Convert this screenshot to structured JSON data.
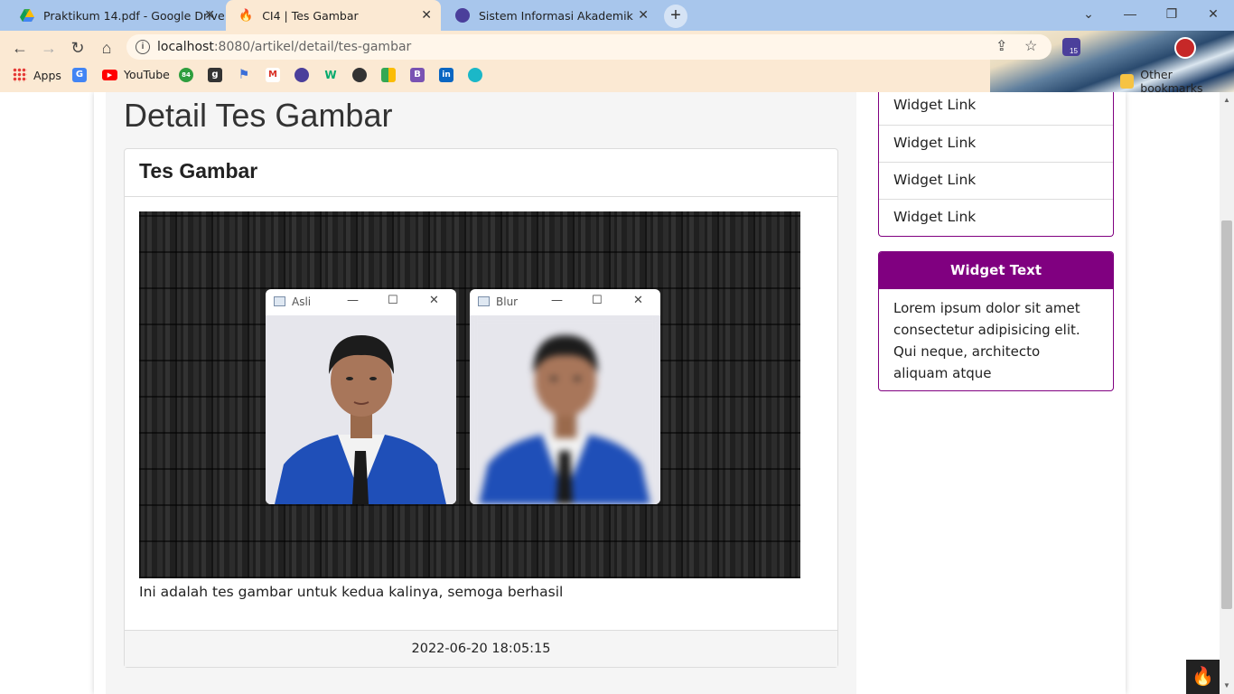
{
  "browser": {
    "tabs": [
      {
        "title": "Praktikum 14.pdf - Google Drive",
        "icon": "google-drive-icon",
        "active": false
      },
      {
        "title": "CI4 | Tes Gambar",
        "icon": "codeigniter-icon",
        "active": true
      },
      {
        "title": "Sistem Informasi Akademik",
        "icon": "campus-icon",
        "active": false
      }
    ],
    "new_tab_label": "+",
    "url_host": "localhost",
    "url_rest": ":8080/artikel/detail/tes-gambar",
    "profile_badge": "15",
    "bookmarks": [
      {
        "label": "Apps",
        "icon": "apps-grid-icon"
      },
      {
        "label": "",
        "icon": "google-translate-icon"
      },
      {
        "label": "YouTube",
        "icon": "youtube-icon"
      },
      {
        "label": "",
        "icon": "bookmark-84-icon",
        "badge": "84"
      },
      {
        "label": "",
        "icon": "goodreads-icon",
        "badge": "g"
      },
      {
        "label": "",
        "icon": "flag-icon"
      },
      {
        "label": "",
        "icon": "gmail-icon",
        "badge": "M"
      },
      {
        "label": "",
        "icon": "campus-icon"
      },
      {
        "label": "",
        "icon": "w3schools-icon",
        "badge": "W"
      },
      {
        "label": "",
        "icon": "github-icon"
      },
      {
        "label": "",
        "icon": "google-meet-icon"
      },
      {
        "label": "",
        "icon": "bootstrap-icon",
        "badge": "B"
      },
      {
        "label": "",
        "icon": "linkedin-icon",
        "badge": "in"
      },
      {
        "label": "",
        "icon": "search-bookmark-icon"
      }
    ],
    "other_bookmarks": "Other bookmarks"
  },
  "page": {
    "title": "Detail Tes Gambar",
    "card_title": "Tes Gambar",
    "image": {
      "windows": [
        {
          "title": "Asli",
          "blurred": false
        },
        {
          "title": "Blur",
          "blurred": true
        }
      ]
    },
    "caption": "Ini adalah tes gambar untuk kedua kalinya, semoga berhasil",
    "footer_date": "2022-06-20 18:05:15"
  },
  "sidebar": {
    "links": [
      "Widget Link",
      "Widget Link",
      "Widget Link",
      "Widget Link"
    ],
    "widget_text_title": "Widget Text",
    "widget_text_body": "Lorem ipsum dolor sit amet consectetur adipisicing elit. Qui neque, architecto aliquam atque"
  },
  "colors": {
    "accent": "#800080",
    "tabbar": "#a8c6ec",
    "toolbar": "#fbe9d3"
  }
}
